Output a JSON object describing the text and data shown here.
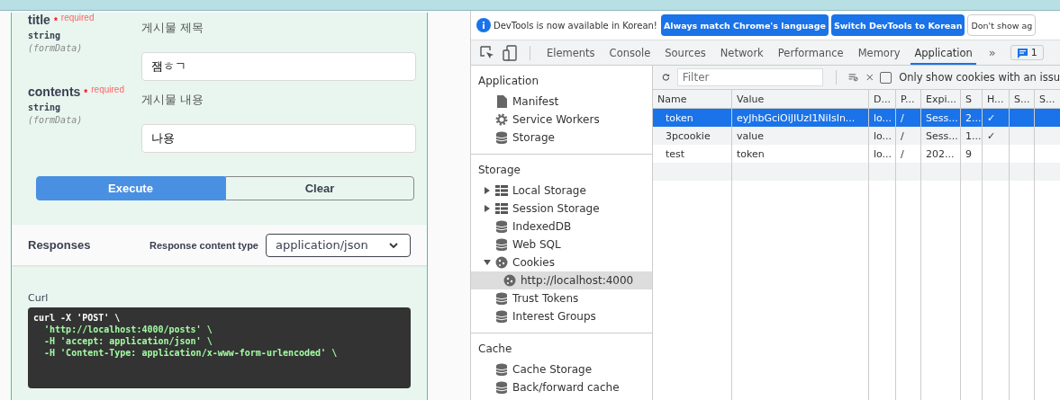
{
  "params": [
    {
      "name": "title",
      "mark": "*",
      "required": "required",
      "type": "string",
      "in": "(formData)",
      "description": "게시물 제목",
      "value": "잼ㅎㄱ"
    },
    {
      "name": "contents",
      "mark": "*",
      "required": "required",
      "type": "string",
      "in": "(formData)",
      "description": "게시물 내용",
      "value": "나용"
    }
  ],
  "buttons": {
    "execute": "Execute",
    "clear": "Clear"
  },
  "responses": {
    "title": "Responses",
    "content_type_label": "Response content type",
    "content_type": "application/json"
  },
  "curl": {
    "label": "Curl",
    "lines": [
      "curl -X 'POST' \\",
      "  'http://localhost:4000/posts' \\",
      "  -H 'accept: application/json' \\",
      "  -H 'Content-Type: application/x-www-form-urlencoded' \\"
    ]
  },
  "infobar": {
    "message": "DevTools is now available in Korean!",
    "buttons": [
      "Always match Chrome's language",
      "Switch DevTools to Korean",
      "Don't show ag"
    ]
  },
  "tabs": [
    {
      "label": "Elements",
      "selected": false
    },
    {
      "label": "Console",
      "selected": false
    },
    {
      "label": "Sources",
      "selected": false
    },
    {
      "label": "Network",
      "selected": false
    },
    {
      "label": "Performance",
      "selected": false
    },
    {
      "label": "Memory",
      "selected": false
    },
    {
      "label": "Application",
      "selected": true
    }
  ],
  "more_tabs": "»",
  "issues_count": "1",
  "sidebar": [
    {
      "title": "Application",
      "items": [
        {
          "label": "Manifest",
          "kind": "file",
          "selected": false
        },
        {
          "label": "Service Workers",
          "kind": "worker",
          "selected": false
        },
        {
          "label": "Storage",
          "kind": "store",
          "selected": false
        }
      ]
    },
    {
      "title": "Storage",
      "items": [
        {
          "label": "Local Storage",
          "kind": "table",
          "expanded": false,
          "selected": false
        },
        {
          "label": "Session Storage",
          "kind": "table",
          "expanded": false,
          "selected": false
        },
        {
          "label": "IndexedDB",
          "kind": "store",
          "selected": false
        },
        {
          "label": "Web SQL",
          "kind": "store",
          "selected": false
        },
        {
          "label": "Cookies",
          "kind": "cookie",
          "expanded": true,
          "selected": false,
          "children": [
            {
              "label": "http://localhost:4000",
              "kind": "cookie",
              "selected": true
            }
          ]
        },
        {
          "label": "Trust Tokens",
          "kind": "store",
          "selected": false
        },
        {
          "label": "Interest Groups",
          "kind": "store",
          "selected": false
        }
      ]
    },
    {
      "title": "Cache",
      "items": [
        {
          "label": "Cache Storage",
          "kind": "store",
          "selected": false
        },
        {
          "label": "Back/forward cache",
          "kind": "store",
          "selected": false
        }
      ]
    }
  ],
  "filter": {
    "placeholder": "Filter",
    "only_issues_label": "Only show cookies with an issu",
    "only_issues_checked": false
  },
  "table": {
    "columns": [
      "Name",
      "Value",
      "D...",
      "P...",
      "Expi...",
      "S",
      "H...",
      "S...",
      "S..."
    ],
    "rows": [
      {
        "cells": [
          "token",
          "eyJhbGciOiJIUzI1NiIsIn...",
          "lo...",
          "/",
          "Sess...",
          "2...",
          "✓",
          "",
          ""
        ],
        "selected": true
      },
      {
        "cells": [
          "3pcookie",
          "value",
          "lo...",
          "/",
          "Sess...",
          "1...",
          "✓",
          "",
          ""
        ],
        "selected": false
      },
      {
        "cells": [
          "test",
          "token",
          "lo...",
          "/",
          "202...",
          "9",
          "",
          "",
          ""
        ],
        "selected": false
      }
    ]
  }
}
